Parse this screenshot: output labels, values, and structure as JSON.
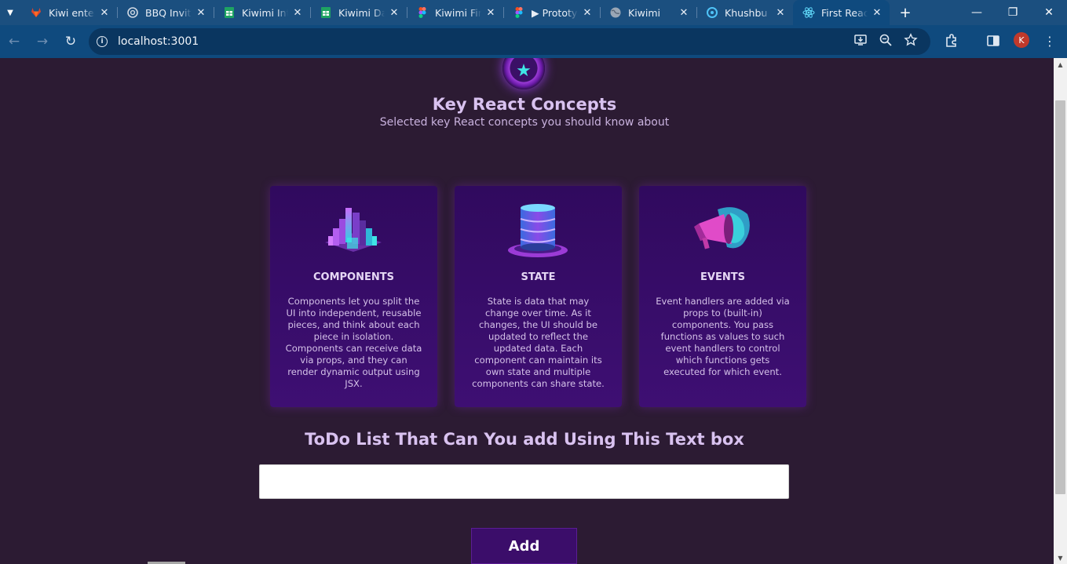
{
  "browser": {
    "tabs": [
      {
        "title": "Kiwi enter",
        "icon": "gitlab-icon",
        "color": "#e24329"
      },
      {
        "title": "BBQ Invita",
        "icon": "chatgpt-icon",
        "color": "#cfd8e3"
      },
      {
        "title": "Kiwimi Int",
        "icon": "sheets-icon",
        "color": "#1ea362"
      },
      {
        "title": "Kiwimi Da",
        "icon": "sheets-icon",
        "color": "#1ea362"
      },
      {
        "title": "Kiwimi Fir",
        "icon": "figma-icon",
        "color": "#f24e1e"
      },
      {
        "title": "▶ Prototy",
        "icon": "figma-icon",
        "color": "#a259ff"
      },
      {
        "title": "Kiwimi",
        "icon": "globe-icon",
        "color": "#9aa7b6"
      },
      {
        "title": "Khushbu",
        "icon": "kiwi-icon",
        "color": "#4fc3f7"
      },
      {
        "title": "First React",
        "icon": "react-icon",
        "color": "#61dafb"
      }
    ],
    "active_tab_index": 8,
    "url": "localhost:3001"
  },
  "page": {
    "heading": "Key React Concepts",
    "subheading": "Selected key React concepts you should know about",
    "concepts": [
      {
        "title": "COMPONENTS",
        "image": "components-image",
        "description": "Components let you split the UI into independent, reusable pieces, and think about each piece in isolation. Components can receive data via props, and they can render dynamic output using JSX."
      },
      {
        "title": "STATE",
        "image": "state-image",
        "description": "State is data that may change over time. As it changes, the UI should be updated to reflect the updated data. Each component can maintain its own state and multiple components can share state."
      },
      {
        "title": "EVENTS",
        "image": "events-image",
        "description": "Event handlers are added via props to (built-in) components. You pass functions as values to such event handlers to control which functions gets executed for which event."
      }
    ],
    "todo": {
      "title": "ToDo List That Can You add Using This Text box",
      "input_value": "",
      "add_label": "Add"
    }
  },
  "colors": {
    "page_bg": "#2c1b33",
    "card_bg": "#300a5e",
    "heading": "#d9c2f0",
    "button_bg": "#3b0d6a",
    "tabstrip_bg": "#1b4f7f"
  }
}
